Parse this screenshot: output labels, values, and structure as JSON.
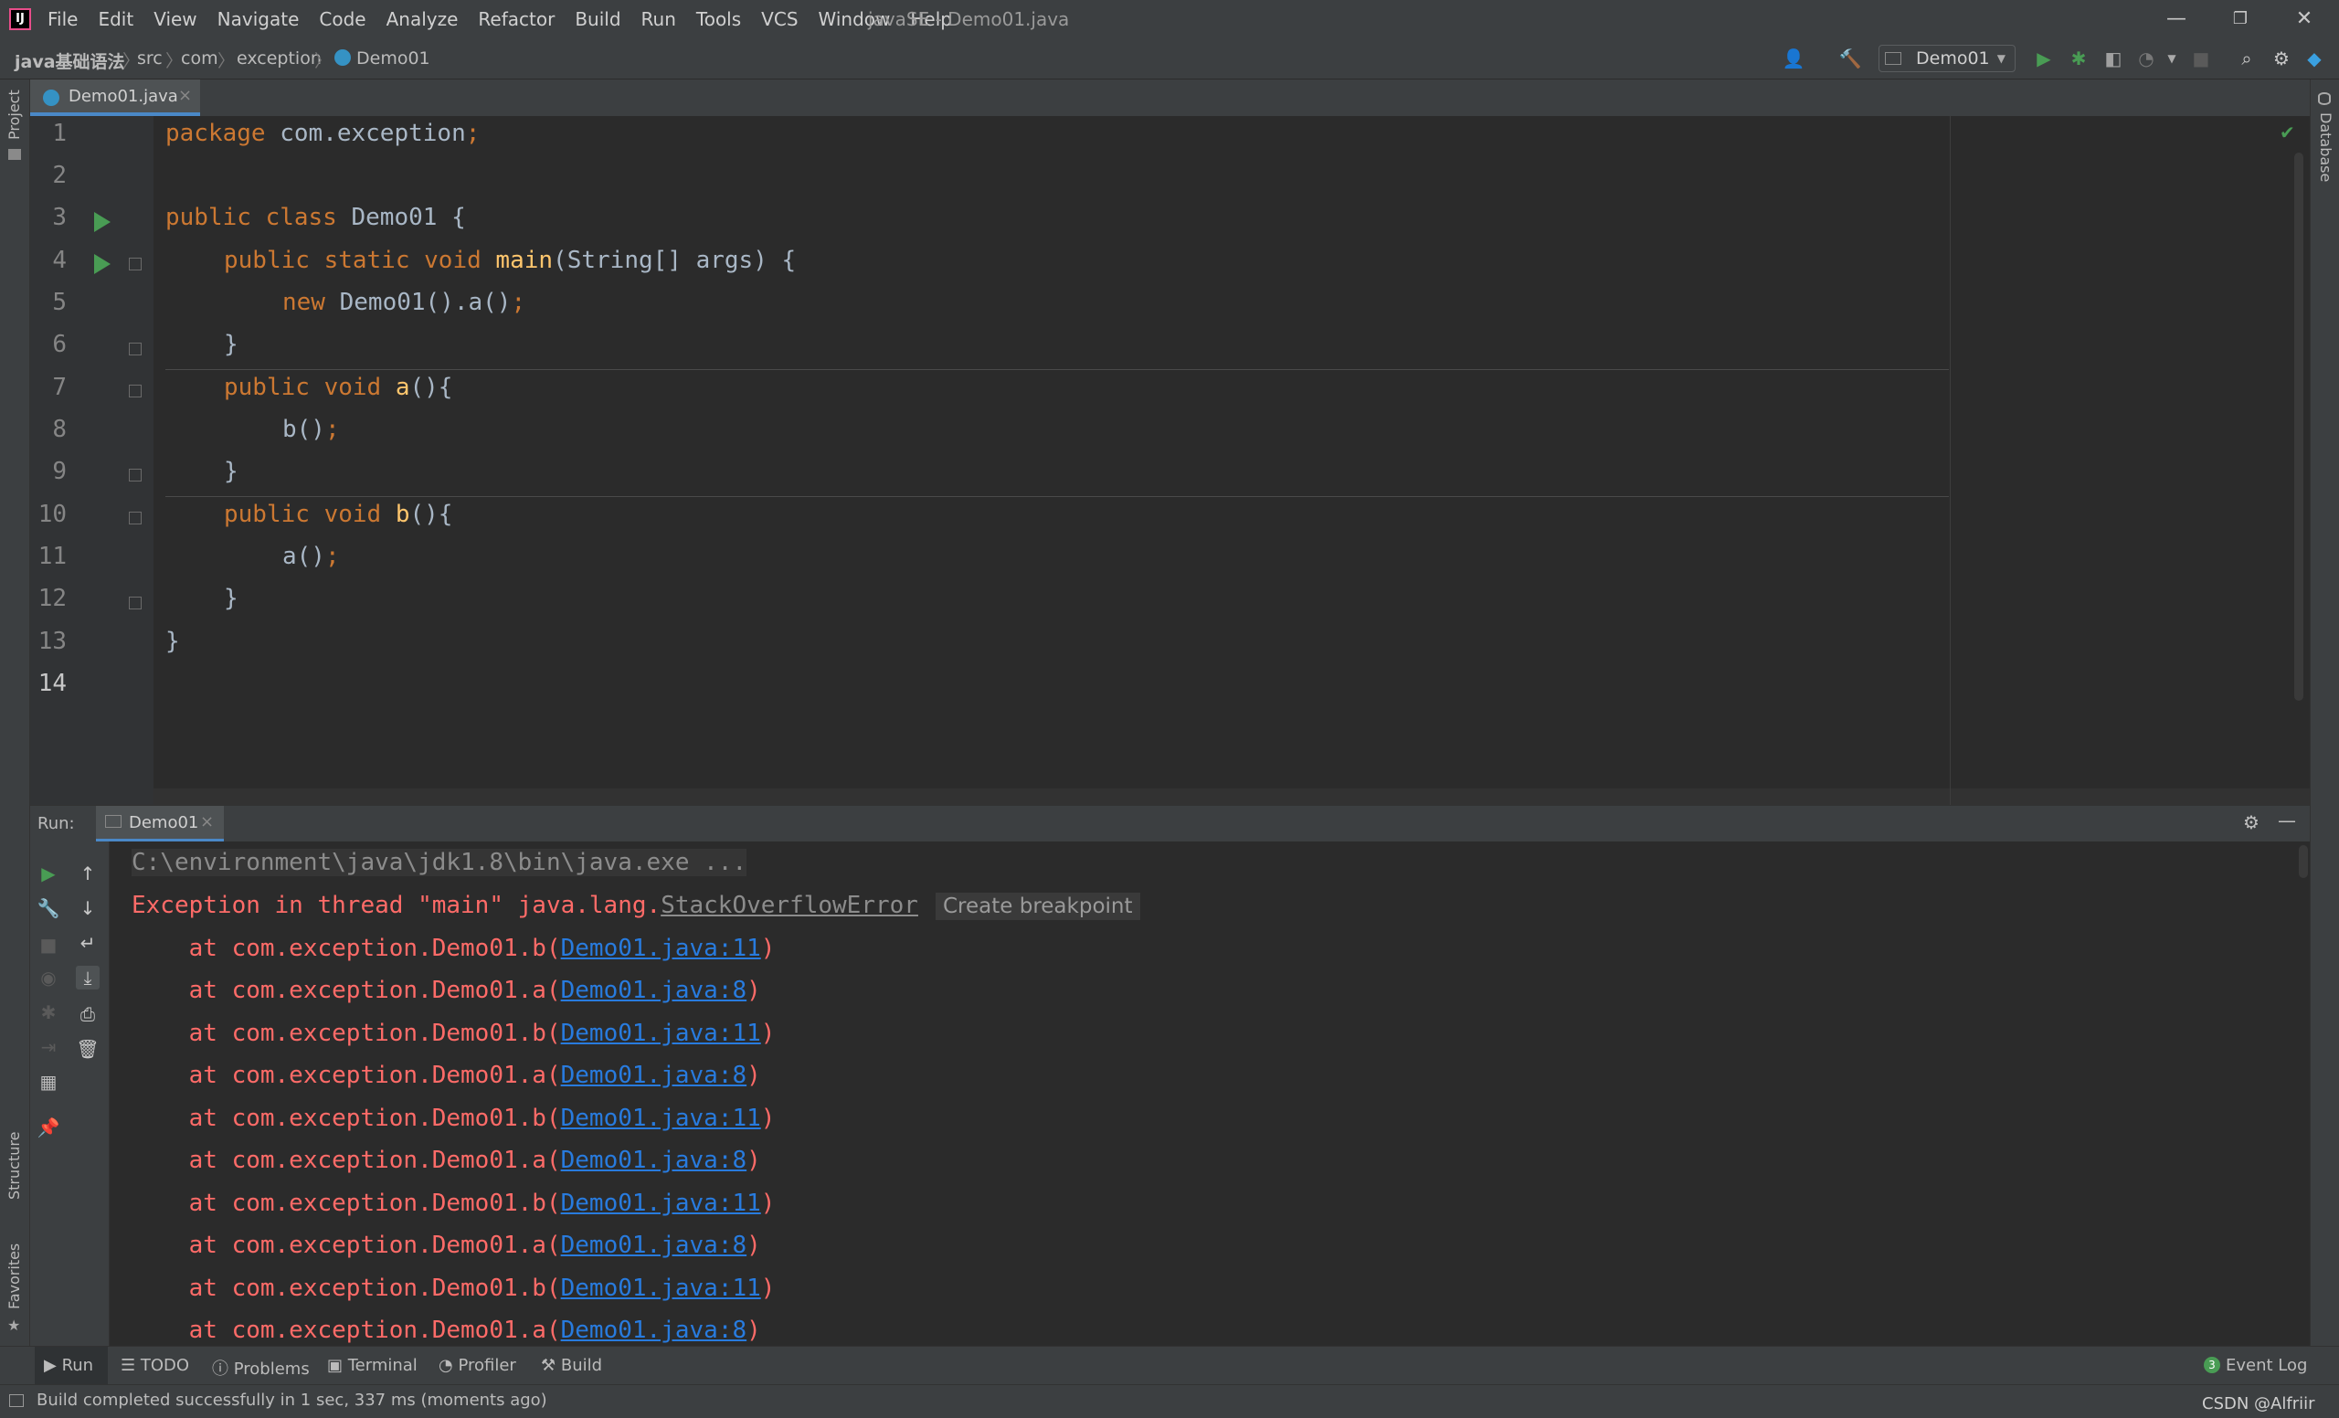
{
  "window": {
    "title": "javaSE - Demo01.java",
    "minimize": "—",
    "restore": "❐",
    "close": "✕"
  },
  "menu": [
    "File",
    "Edit",
    "View",
    "Navigate",
    "Code",
    "Analyze",
    "Refactor",
    "Build",
    "Run",
    "Tools",
    "VCS",
    "Window",
    "Help"
  ],
  "breadcrumb": [
    "java基础语法",
    "src",
    "com",
    "exception",
    "Demo01"
  ],
  "toolbar": {
    "run_config": "Demo01"
  },
  "editor_tab": {
    "label": "Demo01.java",
    "close": "×"
  },
  "side_labels": {
    "project": "Project",
    "structure": "Structure",
    "favorites": "Favorites",
    "database": "Database"
  },
  "line_numbers": [
    "1",
    "2",
    "3",
    "4",
    "5",
    "6",
    "7",
    "8",
    "9",
    "10",
    "11",
    "12",
    "13",
    "14"
  ],
  "code": {
    "l1": {
      "kw": "package",
      "rest": " com.exception",
      "semi": ";"
    },
    "l3": {
      "kw": "public class",
      "rest": " Demo01 {"
    },
    "l4": {
      "kw": "public static void",
      "fn": "main",
      "rest": "(String[] args) {"
    },
    "l5": {
      "kw": "new",
      "rest": " Demo01().a()",
      "semi": ";"
    },
    "l6": "}",
    "l7": {
      "kw": "public void",
      "fn": "a",
      "rest": "(){"
    },
    "l8": {
      "rest": "b()",
      "semi": ";"
    },
    "l9": "}",
    "l10": {
      "kw": "public void",
      "fn": "b",
      "rest": "(){"
    },
    "l11": {
      "rest": "a()",
      "semi": ";"
    },
    "l12": "}",
    "l13": "}"
  },
  "run_panel": {
    "label": "Run:",
    "tab": "Demo01",
    "tab_close": "×"
  },
  "console": {
    "command": "C:\\environment\\java\\jdk1.8\\bin\\java.exe ...",
    "exception_prefix": "Exception in thread \"main\" java.lang.",
    "exception_class": "StackOverflowError",
    "create_breakpoint": "Create breakpoint",
    "frames": [
      {
        "text": "    at com.exception.Demo01.b(",
        "link": "Demo01.java:11",
        "end": ")"
      },
      {
        "text": "    at com.exception.Demo01.a(",
        "link": "Demo01.java:8",
        "end": ")"
      },
      {
        "text": "    at com.exception.Demo01.b(",
        "link": "Demo01.java:11",
        "end": ")"
      },
      {
        "text": "    at com.exception.Demo01.a(",
        "link": "Demo01.java:8",
        "end": ")"
      },
      {
        "text": "    at com.exception.Demo01.b(",
        "link": "Demo01.java:11",
        "end": ")"
      },
      {
        "text": "    at com.exception.Demo01.a(",
        "link": "Demo01.java:8",
        "end": ")"
      },
      {
        "text": "    at com.exception.Demo01.b(",
        "link": "Demo01.java:11",
        "end": ")"
      },
      {
        "text": "    at com.exception.Demo01.a(",
        "link": "Demo01.java:8",
        "end": ")"
      },
      {
        "text": "    at com.exception.Demo01.b(",
        "link": "Demo01.java:11",
        "end": ")"
      },
      {
        "text": "    at com.exception.Demo01.a(",
        "link": "Demo01.java:8",
        "end": ")"
      }
    ]
  },
  "bottom_tools": [
    "Run",
    "TODO",
    "Problems",
    "Terminal",
    "Profiler",
    "Build"
  ],
  "event_log": {
    "count": "3",
    "label": "Event Log"
  },
  "status": {
    "message": "Build completed successfully in 1 sec, 337 ms (moments ago)",
    "watermark": "CSDN @Alfriir"
  },
  "colors": {
    "accent": "#4a88c7",
    "error": "#ff6b68",
    "link": "#287bde",
    "run_green": "#499c54"
  }
}
